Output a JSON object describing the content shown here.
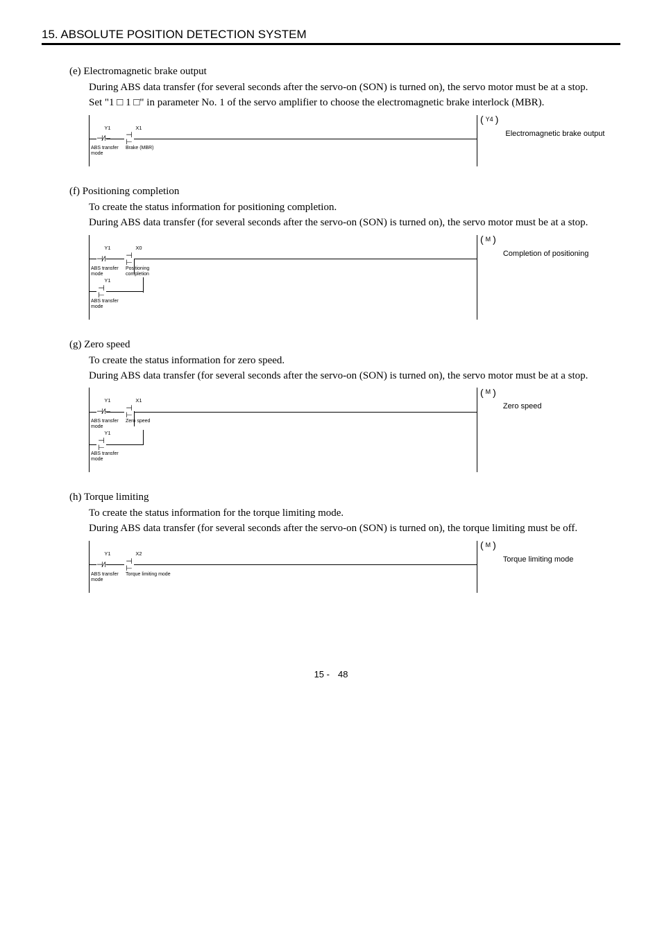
{
  "header": "15. ABSOLUTE POSITION DETECTION SYSTEM",
  "sections": {
    "e": {
      "title": "(e) Electromagnetic brake output",
      "body1": "During ABS data transfer (for several seconds after the servo-on (SON) is turned on), the servo motor must be at a stop.",
      "body2": "Set \"1 □ 1 □\" in parameter No. 1 of the servo amplifier to choose the electromagnetic brake interlock (MBR).",
      "ladder": {
        "y1": "Y1",
        "x1": "X1",
        "y1_desc": "ABS transfer\nmode",
        "x1_desc": "Brake (MBR)",
        "coil": "Y4",
        "side": "Electromagnetic brake output"
      }
    },
    "f": {
      "title": "(f) Positioning completion",
      "body1": "To create the status information for positioning completion.",
      "body2": "During ABS data transfer (for several seconds after the servo-on (SON) is turned on), the servo motor must be at a stop.",
      "ladder": {
        "y1": "Y1",
        "x0": "X0",
        "y1_desc": "ABS transfer\nmode",
        "x0_desc": "Positioning\ncompletion",
        "y1b": "Y1",
        "y1b_desc": "ABS transfer\nmode",
        "coil": "M",
        "side": "Completion of positioning"
      }
    },
    "g": {
      "title": "(g) Zero speed",
      "body1": "To create the status information for zero speed.",
      "body2": "During ABS data transfer (for several seconds after the servo-on (SON) is turned on), the servo motor must be at a stop.",
      "ladder": {
        "y1": "Y1",
        "x1": "X1",
        "y1_desc": "ABS transfer\nmode",
        "x1_desc": "Zero speed",
        "y1b": "Y1",
        "y1b_desc": "ABS transfer\nmode",
        "coil": "M",
        "side": "Zero speed"
      }
    },
    "h": {
      "title": "(h) Torque limiting",
      "body1": "To create the status information for the torque limiting mode.",
      "body2": "During ABS data transfer (for several seconds after the servo-on (SON) is turned on), the torque limiting must be off.",
      "ladder": {
        "y1": "Y1",
        "x2": "X2",
        "y1_desc": "ABS transfer\nmode",
        "x2_desc": "Torque limiting mode",
        "coil": "M",
        "side": "Torque limiting mode"
      }
    }
  },
  "page_prefix": "15 -",
  "page_num": "48"
}
